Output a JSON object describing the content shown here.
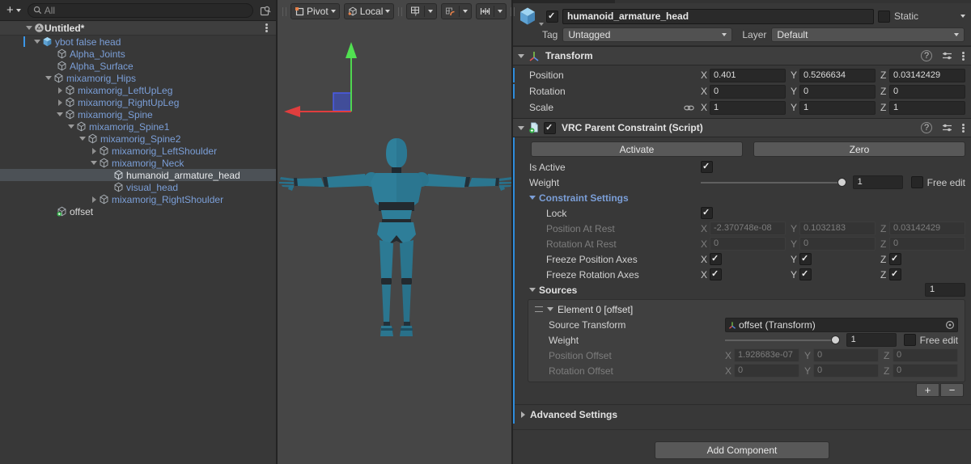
{
  "hierarchy": {
    "add_button": "+",
    "search_placeholder": "All",
    "scene_name": "Untitled*",
    "items": [
      {
        "label": "ybot false head"
      },
      {
        "label": "Alpha_Joints"
      },
      {
        "label": "Alpha_Surface"
      },
      {
        "label": "mixamorig_Hips"
      },
      {
        "label": "mixamorig_LeftUpLeg"
      },
      {
        "label": "mixamorig_RightUpLeg"
      },
      {
        "label": "mixamorig_Spine"
      },
      {
        "label": "mixamorig_Spine1"
      },
      {
        "label": "mixamorig_Spine2"
      },
      {
        "label": "mixamorig_LeftShoulder"
      },
      {
        "label": "mixamorig_Neck"
      },
      {
        "label": "humanoid_armature_head"
      },
      {
        "label": "visual_head"
      },
      {
        "label": "mixamorig_RightShoulder"
      },
      {
        "label": "offset"
      }
    ]
  },
  "scene_toolbar": {
    "pivot_label": "Pivot",
    "local_label": "Local"
  },
  "axis": {
    "x": "X",
    "y": "Y",
    "z": "Z"
  },
  "inspector": {
    "header": {
      "name": "humanoid_armature_head",
      "static_label": "Static",
      "tag_label": "Tag",
      "tag_value": "Untagged",
      "layer_label": "Layer",
      "layer_value": "Default"
    },
    "transform": {
      "title": "Transform",
      "position_label": "Position",
      "rotation_label": "Rotation",
      "scale_label": "Scale",
      "position": {
        "x": "0.401",
        "y": "0.5266634",
        "z": "0.03142429"
      },
      "rotation": {
        "x": "0",
        "y": "0",
        "z": "0"
      },
      "scale": {
        "x": "1",
        "y": "1",
        "z": "1"
      }
    },
    "constraint": {
      "title": "VRC Parent Constraint (Script)",
      "activate_button": "Activate",
      "zero_button": "Zero",
      "is_active_label": "Is Active",
      "weight_label": "Weight",
      "weight_value": "1",
      "free_edit_label": "Free edit",
      "settings_title": "Constraint Settings",
      "lock_label": "Lock",
      "position_at_rest_label": "Position At Rest",
      "position_at_rest": {
        "x": "-2.370748e-08",
        "y": "0.1032183",
        "z": "0.03142429"
      },
      "rotation_at_rest_label": "Rotation At Rest",
      "rotation_at_rest": {
        "x": "0",
        "y": "0",
        "z": "0"
      },
      "freeze_position_label": "Freeze Position Axes",
      "freeze_rotation_label": "Freeze Rotation Axes",
      "sources_title": "Sources",
      "sources_count": "1",
      "element": {
        "title": "Element 0 [offset]",
        "source_transform_label": "Source Transform",
        "source_transform_value": "offset (Transform)",
        "weight_label": "Weight",
        "weight_value": "1",
        "free_edit_label": "Free edit",
        "position_offset_label": "Position Offset",
        "position_offset": {
          "x": "1.928683e-07",
          "y": "0",
          "z": "0"
        },
        "rotation_offset_label": "Rotation Offset",
        "rotation_offset": {
          "x": "0",
          "y": "0",
          "z": "0"
        }
      },
      "add_source": "+",
      "remove_source": "−"
    },
    "advanced_settings_label": "Advanced Settings",
    "add_component_label": "Add Component"
  },
  "states": {
    "go_active": true,
    "static": false,
    "vrc_enabled": true,
    "is_active": true,
    "lock": true,
    "free_edit_main": false,
    "free_edit_element": false,
    "freeze_position": {
      "x": true,
      "y": true,
      "z": true
    },
    "freeze_rotation": {
      "x": true,
      "y": true,
      "z": true
    }
  }
}
